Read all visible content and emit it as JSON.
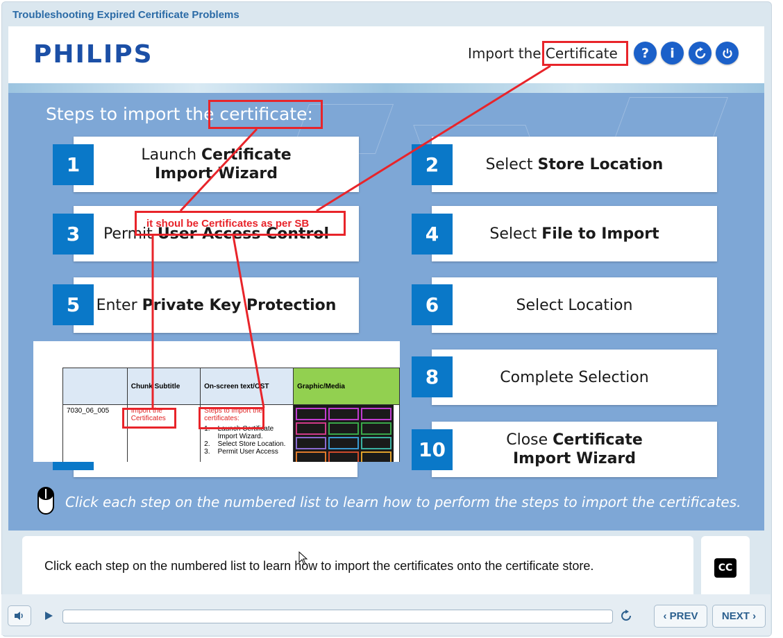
{
  "window": {
    "title": "Troubleshooting  Expired Certificate Problems"
  },
  "header": {
    "logo": "PHILIPS",
    "title": "Import the Certificate",
    "buttons": [
      {
        "label": "?",
        "icon": "help-icon"
      },
      {
        "label": "i",
        "icon": "info-icon"
      },
      {
        "label": "",
        "icon": "replay-icon"
      },
      {
        "label": "",
        "icon": "power-icon"
      }
    ]
  },
  "stage": {
    "title": "Steps to import the certificate:",
    "steps": [
      {
        "num": "1",
        "pre": "Launch ",
        "bold": "Certificate Import Wizard",
        "line1_pre": "Launch ",
        "line1_bold": "Certificate",
        "line2_bold": "Import Wizard"
      },
      {
        "num": "2",
        "pre": "Select ",
        "bold": "Store Location"
      },
      {
        "num": "3",
        "pre": "Permit ",
        "bold": "User Access Control"
      },
      {
        "num": "4",
        "pre": "Select ",
        "bold": "File to Import"
      },
      {
        "num": "5",
        "pre": "Enter ",
        "bold": "Private Key Protection"
      },
      {
        "num": "6",
        "pre": "Select Location",
        "bold": ""
      },
      {
        "num": "8",
        "pre": "Complete Selection",
        "bold": ""
      },
      {
        "num": "10",
        "line1_pre": "Close ",
        "line1_bold": "Certificate",
        "line2_bold": "Import Wizard"
      }
    ],
    "instruction": "Click each step on the numbered list to learn how to perform the steps to import the certificates."
  },
  "overlay_doc": {
    "headers": [
      "",
      "Chunk Subtitle",
      "On-screen text/OST",
      "Graphic/Media"
    ],
    "row_id": "7030_06_005",
    "subtitle_line1": "Import the",
    "subtitle_line2": "Certificates",
    "ost_heading_1": "Steps to import the",
    "ost_heading_2": "certificates:",
    "ost_items": [
      "1.    Launch Certificate",
      "       Import Wizard.",
      "2.    Select Store Location.",
      "3.    Permit User Access"
    ],
    "ost_bold": [
      "Certificate",
      "Store Location",
      "User Access"
    ]
  },
  "annotation": {
    "note": "it shoul be Certificates as per SB",
    "color": "#e8242a"
  },
  "caption": {
    "text": "Click each step on the numbered list to learn how to import the certificates onto the certificate store.",
    "cc_label": "CC"
  },
  "player": {
    "prev_label": "PREV",
    "next_label": "NEXT",
    "progress": 0
  }
}
